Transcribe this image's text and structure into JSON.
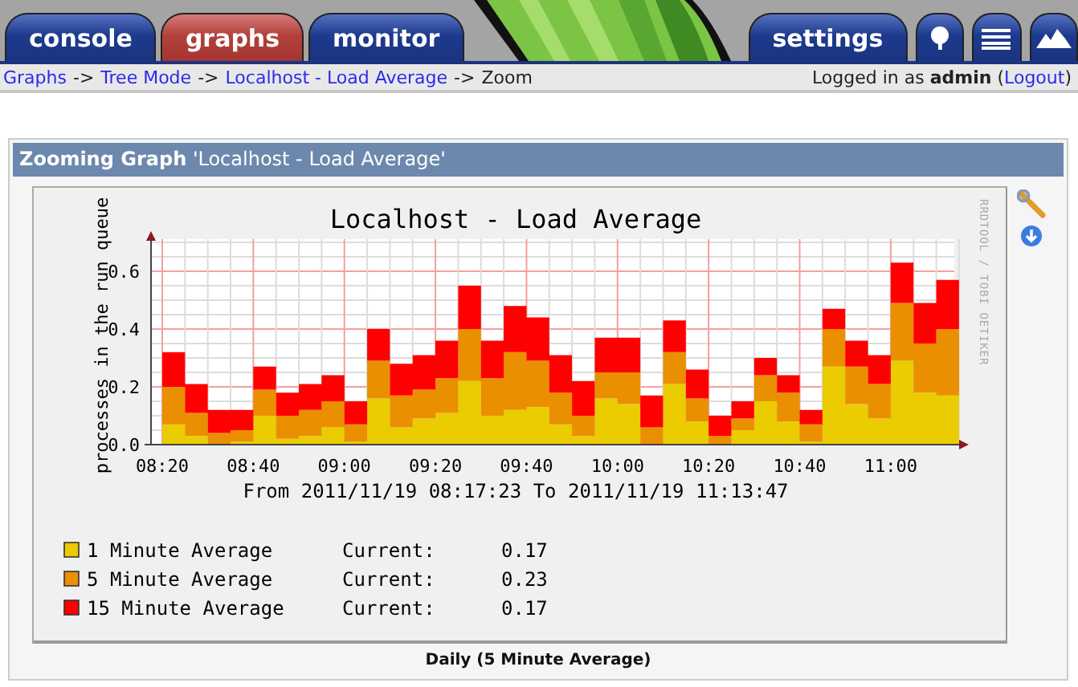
{
  "tabs": [
    {
      "label": "console",
      "selected": false
    },
    {
      "label": "graphs",
      "selected": true
    },
    {
      "label": "monitor",
      "selected": false
    },
    {
      "label": "settings",
      "selected": false
    }
  ],
  "breadcrumb": [
    {
      "kind": "link",
      "label": "Graphs"
    },
    {
      "kind": "separator",
      "label": "->"
    },
    {
      "kind": "link",
      "label": "Tree Mode"
    },
    {
      "kind": "separator",
      "label": "->"
    },
    {
      "kind": "link",
      "label": "Localhost - Load Average"
    },
    {
      "kind": "separator",
      "label": "->"
    },
    {
      "kind": "text",
      "label": "Zoom"
    }
  ],
  "login_status": {
    "before": "Logged in as **admin** (",
    "link": "Logout",
    "after": ")"
  },
  "panel": {
    "title": "**Zooming Graph** 'Localhost - Load Average'",
    "caption": "Daily (5 Minute Average)"
  },
  "graph": {
    "side_text": "RRDTOOL / TOBI OETIKER",
    "range_text": "From 2011/11/19 08:17:23 To 2011/11/19 11:13:47",
    "chart_data": {
      "type": "area",
      "stacked": true,
      "title": "Localhost - Load Average",
      "ylabel": "processes in the run queue",
      "grid": true,
      "legend": true,
      "categories": [
        "08:20",
        null,
        null,
        null,
        "08:40",
        null,
        null,
        null,
        "09:00",
        null,
        null,
        null,
        "09:20",
        null,
        null,
        null,
        "09:40",
        null,
        null,
        null,
        "10:00",
        null,
        null,
        null,
        "10:20",
        null,
        null,
        null,
        "10:40",
        null,
        null,
        null,
        "11:00",
        null,
        null
      ],
      "series": [
        {
          "name": "1 Minute Average",
          "color": "#eacc00",
          "values": [
            0.07,
            0.03,
            0.0,
            0.01,
            0.1,
            0.02,
            0.03,
            0.06,
            0.01,
            0.16,
            0.06,
            0.09,
            0.11,
            0.22,
            0.1,
            0.12,
            0.13,
            0.07,
            0.03,
            0.16,
            0.14,
            0.0,
            0.21,
            0.08,
            0.0,
            0.05,
            0.15,
            0.08,
            0.01,
            0.27,
            0.14,
            0.09,
            0.29,
            0.18,
            0.17
          ]
        },
        {
          "name": "5 Minute Average",
          "color": "#ea8f00",
          "values": [
            0.13,
            0.08,
            0.04,
            0.04,
            0.09,
            0.08,
            0.09,
            0.09,
            0.06,
            0.13,
            0.11,
            0.1,
            0.12,
            0.18,
            0.13,
            0.2,
            0.16,
            0.11,
            0.07,
            0.09,
            0.11,
            0.06,
            0.11,
            0.08,
            0.03,
            0.04,
            0.09,
            0.1,
            0.06,
            0.13,
            0.13,
            0.12,
            0.2,
            0.17,
            0.23
          ]
        },
        {
          "name": "15 Minute Average",
          "color": "#ff0000",
          "values": [
            0.12,
            0.1,
            0.08,
            0.07,
            0.08,
            0.08,
            0.09,
            0.09,
            0.08,
            0.11,
            0.11,
            0.12,
            0.13,
            0.15,
            0.13,
            0.16,
            0.15,
            0.13,
            0.12,
            0.12,
            0.12,
            0.11,
            0.11,
            0.1,
            0.07,
            0.06,
            0.06,
            0.06,
            0.05,
            0.07,
            0.09,
            0.1,
            0.14,
            0.14,
            0.17
          ]
        }
      ],
      "ylim": [
        0,
        0.7
      ],
      "yticks": [
        {
          "value": 0,
          "label": "0.0"
        },
        {
          "value": 0.2,
          "label": "0.2"
        },
        {
          "value": 0.4,
          "label": "0.4"
        },
        {
          "value": 0.6,
          "label": "0.6"
        }
      ]
    },
    "legend_values": [
      {
        "current_label": "Current:",
        "current": "0.17"
      },
      {
        "current_label": "Current:",
        "current": "0.23"
      },
      {
        "current_label": "Current:",
        "current": "0.17"
      }
    ]
  }
}
